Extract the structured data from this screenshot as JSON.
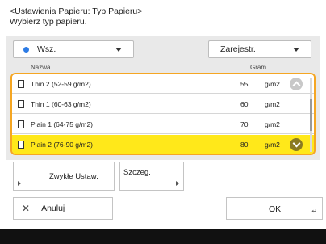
{
  "header": {
    "line1": "<Ustawienia Papieru: Typ Papieru>",
    "line2": "Wybierz typ papieru."
  },
  "filter": {
    "left_value": "Wsz.",
    "right_value": "Zarejestr."
  },
  "columns": {
    "name": "Nazwa",
    "gram": "Gram."
  },
  "papers": [
    {
      "name": "Thin 2 (52-59 g/m2)",
      "gram": "55",
      "unit": "g/m2"
    },
    {
      "name": "Thin 1 (60-63 g/m2)",
      "gram": "60",
      "unit": "g/m2"
    },
    {
      "name": "Plain 1 (64-75 g/m2)",
      "gram": "70",
      "unit": "g/m2"
    },
    {
      "name": "Plain 2 (76-90 g/m2)",
      "gram": "80",
      "unit": "g/m2"
    }
  ],
  "selected_index": 3,
  "buttons": {
    "common": "Zwykłe Ustaw.",
    "detail": "Szczeg.",
    "cancel": "Anuluj",
    "ok": "OK"
  },
  "colors": {
    "selection": "#ffe81a",
    "focus_border": "#f5a623"
  }
}
